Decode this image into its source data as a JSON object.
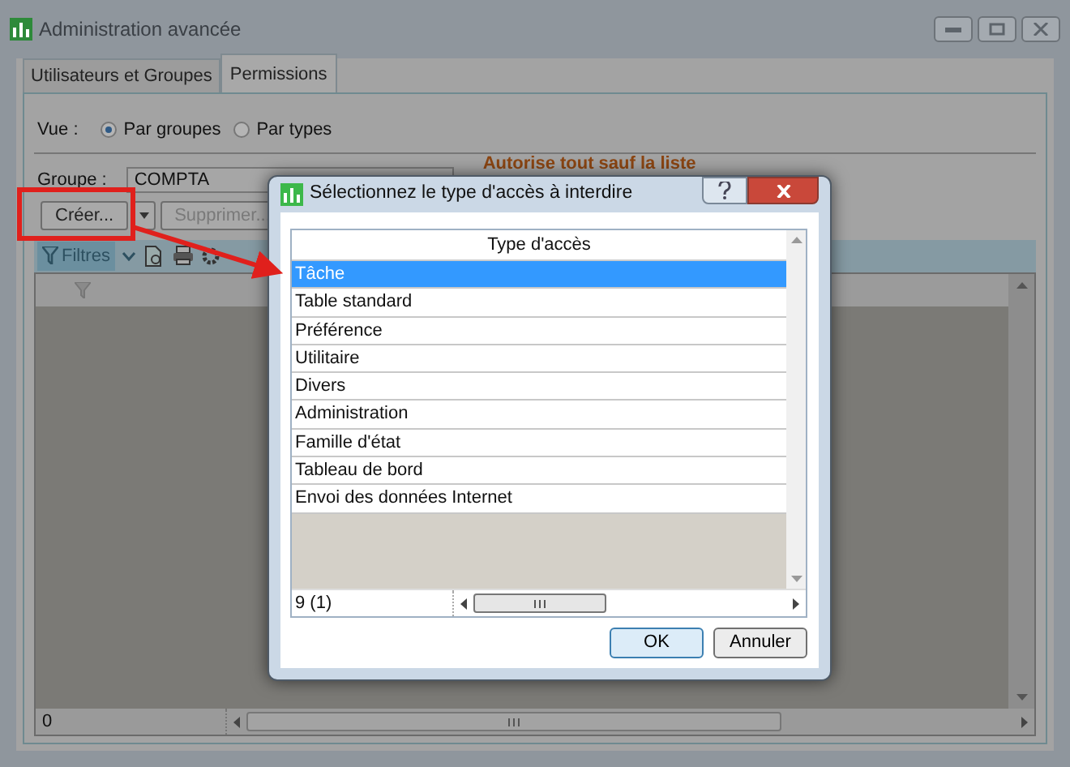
{
  "window": {
    "title": "Administration avancée"
  },
  "tabs": [
    {
      "label": "Utilisateurs et Groupes",
      "selected": false
    },
    {
      "label": "Permissions",
      "selected": true
    }
  ],
  "view": {
    "label": "Vue :",
    "options": [
      {
        "label": "Par groupes",
        "selected": true
      },
      {
        "label": "Par types",
        "selected": false
      }
    ]
  },
  "group": {
    "label": "Groupe :",
    "value": "COMPTA"
  },
  "rule_note": "Autorise tout sauf la liste",
  "buttons": [
    {
      "label": "Créer...",
      "disabled": false
    },
    {
      "label": "Supprimer...",
      "disabled": true
    }
  ],
  "toolbar": {
    "filter_label": "Filtres"
  },
  "status": {
    "count": "0"
  },
  "dialog": {
    "title": "Sélectionnez le type d'accès à interdire",
    "column": "Type d'accès",
    "rows": [
      {
        "label": "Tâche",
        "selected": true
      },
      {
        "label": "Table standard",
        "selected": false
      },
      {
        "label": "Préférence",
        "selected": false
      },
      {
        "label": "Utilitaire",
        "selected": false
      },
      {
        "label": "Divers",
        "selected": false
      },
      {
        "label": "Administration",
        "selected": false
      },
      {
        "label": "Famille d'état",
        "selected": false
      },
      {
        "label": "Tableau de bord",
        "selected": false
      },
      {
        "label": "Envoi des données Internet",
        "selected": false
      }
    ],
    "count": "9 (1)",
    "buttons": [
      {
        "label": "OK",
        "kind": "default"
      },
      {
        "label": "Annuler",
        "kind": "normal"
      }
    ]
  }
}
